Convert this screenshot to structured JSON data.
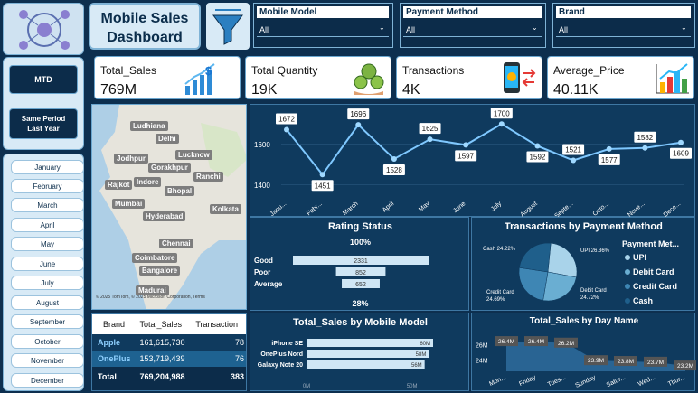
{
  "header": {
    "title_line1": "Mobile Sales",
    "title_line2": "Dashboard"
  },
  "filters": [
    {
      "label": "Mobile Model",
      "value": "All"
    },
    {
      "label": "Payment Method",
      "value": "All"
    },
    {
      "label": "Brand",
      "value": "All"
    }
  ],
  "period_buttons": {
    "mtd": "MTD",
    "spl": "Same Period Last Year"
  },
  "months": [
    "January",
    "February",
    "March",
    "April",
    "May",
    "June",
    "July",
    "August",
    "September",
    "October",
    "November",
    "December"
  ],
  "kpis": [
    {
      "label": "Total_Sales",
      "value": "769M",
      "icon": "dollar-chart-icon"
    },
    {
      "label": "Total Quantity",
      "value": "19K",
      "icon": "money-bags-icon"
    },
    {
      "label": "Transactions",
      "value": "4K",
      "icon": "mobile-payment-icon"
    },
    {
      "label": "Average_Price",
      "value": "40.11K",
      "icon": "bar-chart-icon"
    }
  ],
  "map": {
    "cities": [
      "Ludhiana",
      "Delhi",
      "Lucknow",
      "Jodhpur",
      "Gorakhpur",
      "Ranchi",
      "Rajkot",
      "Indore",
      "Bhopal",
      "Mumbai",
      "Kolkata",
      "Hyderabad",
      "Chennai",
      "Coimbatore",
      "Bangalore",
      "Madurai"
    ],
    "attribution": "© 2025 TomTom, © 2025 Microsoft Corporation, Terms"
  },
  "chart_data": [
    {
      "type": "line",
      "categories": [
        "January",
        "February",
        "March",
        "April",
        "May",
        "June",
        "July",
        "August",
        "September",
        "October",
        "November",
        "December"
      ],
      "tick_labels": [
        "Janu...",
        "Febr...",
        "March",
        "April",
        "May",
        "June",
        "July",
        "August",
        "Septe...",
        "Octo...",
        "Nove...",
        "Dece..."
      ],
      "values": [
        1672,
        1451,
        1696,
        1528,
        1625,
        1597,
        1700,
        1592,
        1521,
        1577,
        1582,
        1609
      ],
      "yticks": [
        1400,
        1600
      ],
      "ylim": [
        1350,
        1750
      ]
    },
    {
      "type": "bar",
      "title": "Rating Status",
      "top_label": "100%",
      "bottom_label": "28%",
      "categories": [
        "Good",
        "Poor",
        "Average"
      ],
      "values": [
        2331,
        852,
        652
      ]
    },
    {
      "type": "pie",
      "title": "Transactions by Payment Method",
      "legend_title": "Payment Met...",
      "categories": [
        "UPI",
        "Debit Card",
        "Credit Card",
        "Cash"
      ],
      "values": [
        26.36,
        24.72,
        24.69,
        24.22
      ],
      "slice_labels": [
        "UPI 26.36%",
        "Debit Card 24.72%",
        "Credit Card 24.69%",
        "Cash 24.22%"
      ],
      "colors": [
        "#a9d3ea",
        "#6aaed2",
        "#3e86b4",
        "#1f5f8b"
      ]
    },
    {
      "type": "bar",
      "title": "Total_Sales by Mobile Model",
      "categories": [
        "iPhone SE",
        "OnePlus Nord",
        "Galaxy Note 20"
      ],
      "values": [
        60,
        58,
        56
      ],
      "value_labels": [
        "60M",
        "58M",
        "56M"
      ],
      "xticks": [
        "0M",
        "50M"
      ]
    },
    {
      "type": "area",
      "title": "Total_Sales by Day Name",
      "categories": [
        "Monday",
        "Friday",
        "Tuesday",
        "Sunday",
        "Saturday",
        "Wednesday",
        "Thursday"
      ],
      "tick_labels": [
        "Mon...",
        "Friday",
        "Tues...",
        "Sunday",
        "Satur...",
        "Wed...",
        "Thur..."
      ],
      "values": [
        26.4,
        26.4,
        26.2,
        23.9,
        23.8,
        23.7,
        23.2
      ],
      "value_labels": [
        "26.4M",
        "26.4M",
        "26.2M",
        "23.9M",
        "23.8M",
        "23.7M",
        "23.2M"
      ],
      "yticks": [
        "24M",
        "26M"
      ]
    }
  ],
  "table": {
    "headers": [
      "Brand",
      "Total_Sales",
      "Transaction"
    ],
    "rows": [
      {
        "brand": "Apple",
        "sales": "161,615,730",
        "tx": "78"
      },
      {
        "brand": "OnePlus",
        "sales": "153,719,439",
        "tx": "76"
      }
    ],
    "total": {
      "brand": "Total",
      "sales": "769,204,988",
      "tx": "383"
    }
  }
}
